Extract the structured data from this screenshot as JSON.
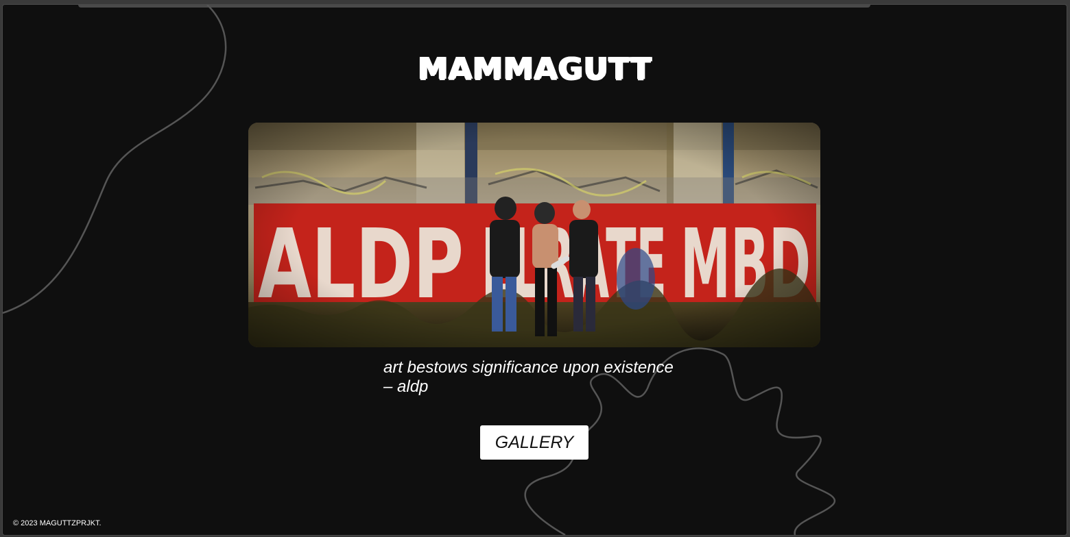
{
  "header": {
    "logo_text": "MAMMAGUTT"
  },
  "hero": {
    "image_alt": "graffiti wall with three people",
    "wall_letters": "ALDP ELRATE MBD"
  },
  "quote": {
    "line1": "art bestows significance upon existence",
    "line2": "– aldp"
  },
  "nav": {
    "gallery_label": "GALLERY"
  },
  "footer": {
    "copyright": "© 2023 MAGUTTZPRJKT."
  },
  "colors": {
    "background": "#0f0f0f",
    "text": "#ffffff",
    "wall_red": "#c4231b",
    "button_bg": "#ffffff"
  }
}
